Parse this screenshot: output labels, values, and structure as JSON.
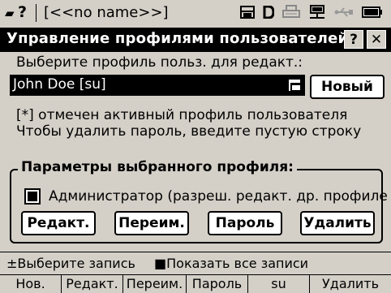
{
  "statusbar": {
    "doc_name": "[<<no name>>]",
    "question_mark": "?",
    "icons": [
      "disk-icon",
      "d-letter-icon",
      "printer-icon",
      "network-icon",
      "usb-icon",
      "battery-icon"
    ]
  },
  "window": {
    "title": "Управление профилями пользователей",
    "help_label": "?",
    "close_label": "✕"
  },
  "form": {
    "select_prompt": "Выберите профиль польз. для редакт.:",
    "profile_value": "John Doe [su]",
    "new_button": "Новый",
    "note_active": "[*] отмечен активный профиль пользователя",
    "note_password": "Чтобы удалить пароль, введите пустую строку"
  },
  "group": {
    "title": "Параметры выбранного профиля:",
    "admin_label": "Администратор (разреш. редакт. др. профиле",
    "admin_checked": true,
    "buttons": {
      "edit": "Редакт.",
      "rename": "Переим.",
      "password": "Пароль",
      "delete": "Удалить"
    }
  },
  "hints": {
    "select_record": "±Выберите запись",
    "show_all": "■Показать все записи"
  },
  "softkeys": [
    "Нов.",
    "Редакт.",
    "Переим.",
    "Пароль",
    "su",
    "Удалить"
  ],
  "colors": {
    "background": "#d4d0c8",
    "titlebar": "#000000",
    "selection": "#000000"
  }
}
